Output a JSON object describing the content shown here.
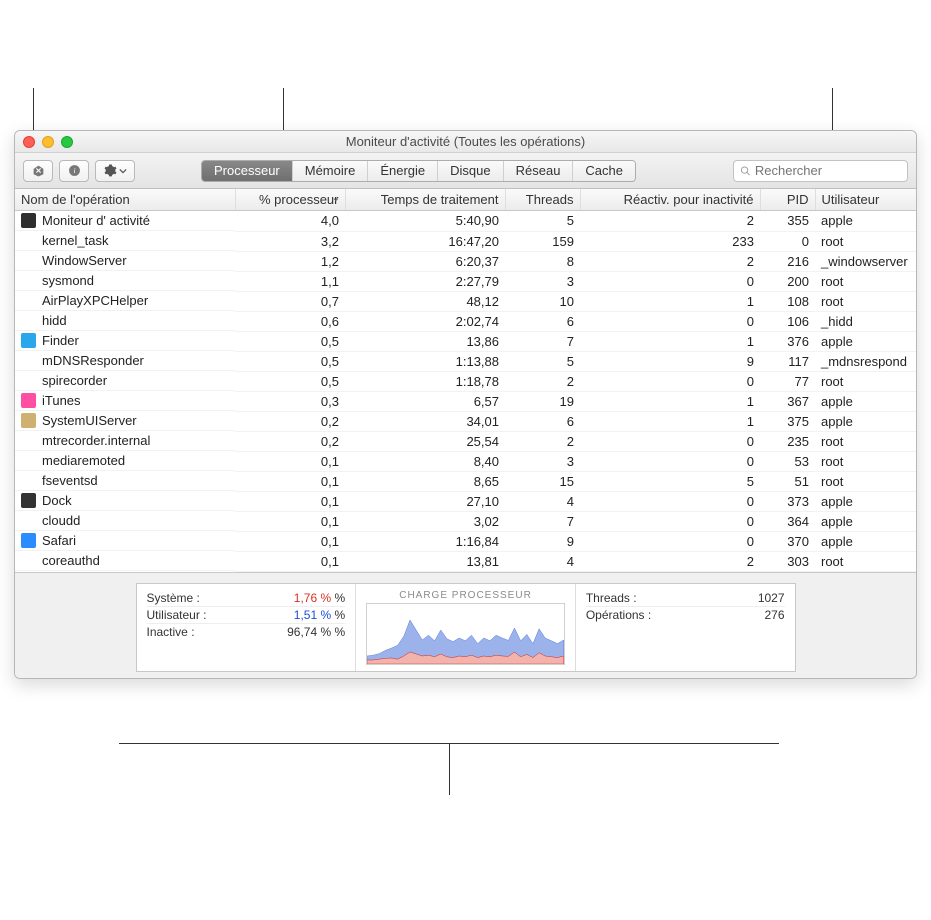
{
  "window": {
    "title": "Moniteur d'activité (Toutes les opérations)",
    "search_placeholder": "Rechercher",
    "tabs": [
      "Processeur",
      "Mémoire",
      "Énergie",
      "Disque",
      "Réseau",
      "Cache"
    ],
    "active_tab": 0
  },
  "columns": {
    "name": "Nom de l'opération",
    "cpu": "% processeur",
    "time": "Temps de traitement",
    "threads": "Threads",
    "idle_wake": "Réactiv. pour inactivité",
    "pid": "PID",
    "user": "Utilisateur"
  },
  "processes": [
    {
      "icon": "activity",
      "name": "Moniteur d'  activité",
      "cpu": "4,0",
      "time": "5:40,90",
      "threads": "5",
      "idle": "2",
      "pid": "355",
      "user": "apple"
    },
    {
      "icon": "",
      "name": "kernel_task",
      "cpu": "3,2",
      "time": "16:47,20",
      "threads": "159",
      "idle": "233",
      "pid": "0",
      "user": "root"
    },
    {
      "icon": "",
      "name": "WindowServer",
      "cpu": "1,2",
      "time": "6:20,37",
      "threads": "8",
      "idle": "2",
      "pid": "216",
      "user": "_windowserver"
    },
    {
      "icon": "",
      "name": "sysmond",
      "cpu": "1,1",
      "time": "2:27,79",
      "threads": "3",
      "idle": "0",
      "pid": "200",
      "user": "root"
    },
    {
      "icon": "",
      "name": "AirPlayXPCHelper",
      "cpu": "0,7",
      "time": "48,12",
      "threads": "10",
      "idle": "1",
      "pid": "108",
      "user": "root"
    },
    {
      "icon": "",
      "name": "hidd",
      "cpu": "0,6",
      "time": "2:02,74",
      "threads": "6",
      "idle": "0",
      "pid": "106",
      "user": "_hidd"
    },
    {
      "icon": "finder",
      "name": "Finder",
      "cpu": "0,5",
      "time": "13,86",
      "threads": "7",
      "idle": "1",
      "pid": "376",
      "user": "apple"
    },
    {
      "icon": "",
      "name": "mDNSResponder",
      "cpu": "0,5",
      "time": "1:13,88",
      "threads": "5",
      "idle": "9",
      "pid": "117",
      "user": "_mdnsrespond"
    },
    {
      "icon": "",
      "name": "spirecorder",
      "cpu": "0,5",
      "time": "1:18,78",
      "threads": "2",
      "idle": "0",
      "pid": "77",
      "user": "root"
    },
    {
      "icon": "itunes",
      "name": "iTunes",
      "cpu": "0,3",
      "time": "6,57",
      "threads": "19",
      "idle": "1",
      "pid": "367",
      "user": "apple"
    },
    {
      "icon": "system",
      "name": "SystemUIServer",
      "cpu": "0,2",
      "time": "34,01",
      "threads": "6",
      "idle": "1",
      "pid": "375",
      "user": "apple"
    },
    {
      "icon": "",
      "name": "mtrecorder.internal",
      "cpu": "0,2",
      "time": "25,54",
      "threads": "2",
      "idle": "0",
      "pid": "235",
      "user": "root"
    },
    {
      "icon": "",
      "name": "mediaremoted",
      "cpu": "0,1",
      "time": "8,40",
      "threads": "3",
      "idle": "0",
      "pid": "53",
      "user": "root"
    },
    {
      "icon": "",
      "name": "fseventsd",
      "cpu": "0,1",
      "time": "8,65",
      "threads": "15",
      "idle": "5",
      "pid": "51",
      "user": "root"
    },
    {
      "icon": "dock",
      "name": "Dock",
      "cpu": "0,1",
      "time": "27,10",
      "threads": "4",
      "idle": "0",
      "pid": "373",
      "user": "apple"
    },
    {
      "icon": "",
      "name": "cloudd",
      "cpu": "0,1",
      "time": "3,02",
      "threads": "7",
      "idle": "0",
      "pid": "364",
      "user": "apple"
    },
    {
      "icon": "safari",
      "name": "Safari",
      "cpu": "0,1",
      "time": "1:16,84",
      "threads": "9",
      "idle": "0",
      "pid": "370",
      "user": "apple"
    },
    {
      "icon": "",
      "name": "coreauthd",
      "cpu": "0,1",
      "time": "13,81",
      "threads": "4",
      "idle": "2",
      "pid": "303",
      "user": "root"
    }
  ],
  "footer": {
    "left": {
      "system_label": "Système :",
      "system_value": "1,76 %",
      "system_suffix": "%",
      "user_label": "Utilisateur :",
      "user_value": "1,51 %",
      "user_suffix": "%",
      "idle_label": "Inactive :",
      "idle_value": "96,74 %",
      "idle_suffix": "%"
    },
    "center_title": "CHARGE PROCESSEUR",
    "right": {
      "threads_label": "Threads :",
      "threads_value": "1027",
      "ops_label": "Opérations :",
      "ops_value": "276"
    }
  },
  "chart_data": {
    "type": "area",
    "title": "CHARGE PROCESSEUR",
    "x": "time (relative samples)",
    "ylabel": "% CPU",
    "ylim": [
      0,
      15
    ],
    "series": [
      {
        "name": "Système",
        "color": "#d93025",
        "values": [
          1,
          1,
          1.2,
          1.4,
          1.5,
          1.2,
          2,
          3,
          2.5,
          2,
          2.2,
          1.8,
          2.5,
          1.8,
          1.6,
          2,
          1.8,
          2.2,
          1.6,
          2,
          1.8,
          2.2,
          2,
          1.9,
          3,
          1.8,
          2.4,
          1.6,
          2.8,
          2,
          1.8,
          1.6,
          2
        ]
      },
      {
        "name": "Utilisateur",
        "color": "#5a7de0",
        "values": [
          1,
          1.2,
          1.4,
          2,
          2.5,
          3.5,
          5,
          8,
          6,
          4,
          5,
          4,
          6,
          4.5,
          4,
          4.5,
          4,
          5,
          3.5,
          4.5,
          4,
          5,
          4.5,
          4,
          6,
          4,
          5,
          3.5,
          6,
          4.5,
          4,
          3.5,
          4
        ]
      }
    ]
  },
  "icons": {
    "activity": "#2e2e2e",
    "finder": "#2aa7ea",
    "itunes": "#ff4fa3",
    "system": "#d0b070",
    "dock": "#333333",
    "safari": "#2a8cff"
  }
}
